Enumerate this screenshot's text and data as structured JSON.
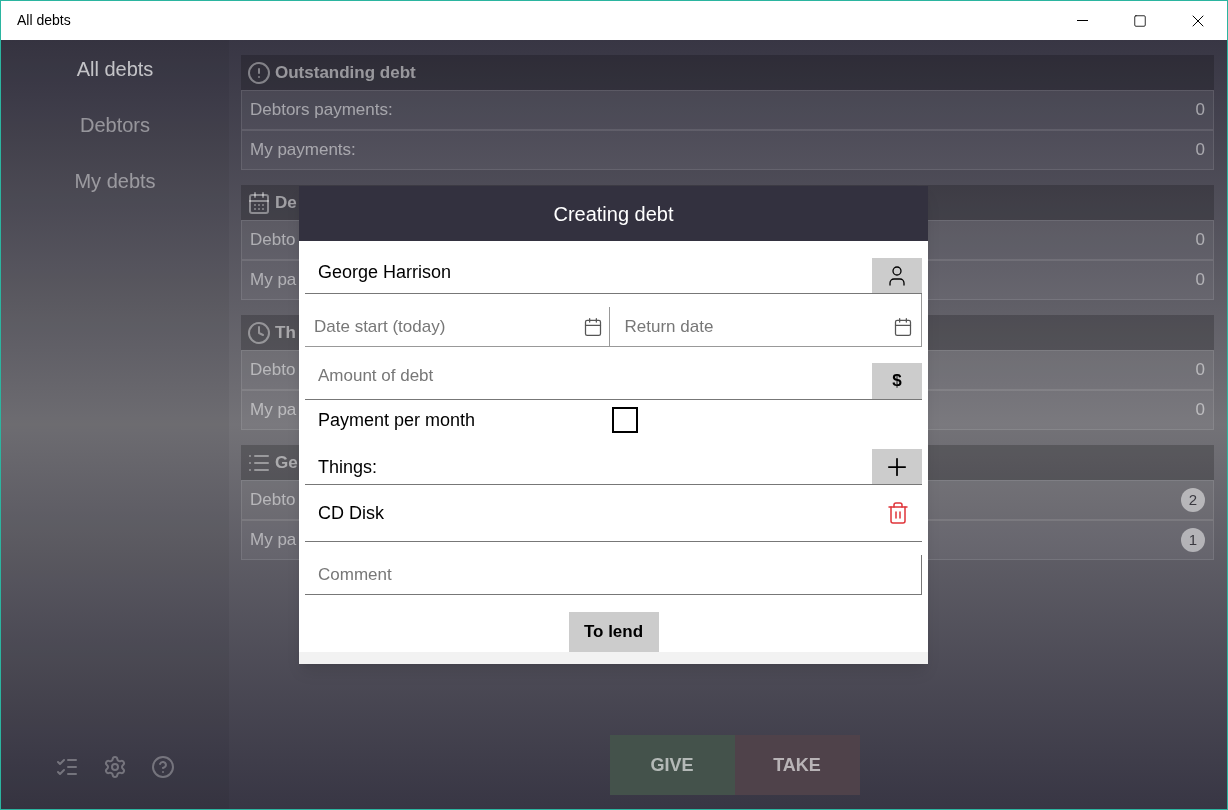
{
  "window": {
    "title": "All debts"
  },
  "sidebar": {
    "items": [
      {
        "label": "All debts",
        "selected": true
      },
      {
        "label": "Debtors",
        "selected": false
      },
      {
        "label": "My debts",
        "selected": false
      }
    ]
  },
  "sections": [
    {
      "title": "Outstanding debt",
      "rows": [
        {
          "kind": "text",
          "label": "Debtors payments:",
          "value": "0"
        },
        {
          "kind": "text",
          "label": "My payments:",
          "value": "0"
        }
      ]
    },
    {
      "title": "De",
      "rows": [
        {
          "kind": "text",
          "label": "Debto",
          "value": "0"
        },
        {
          "kind": "text",
          "label": "My pa",
          "value": "0"
        }
      ]
    },
    {
      "title": "Th",
      "rows": [
        {
          "kind": "text",
          "label": "Debto",
          "value": "0"
        },
        {
          "kind": "text",
          "label": "My pa",
          "value": "0"
        }
      ]
    },
    {
      "title": "Ge",
      "rows": [
        {
          "kind": "badge",
          "label": "Debto",
          "value": "2"
        },
        {
          "kind": "badge",
          "label": "My pa",
          "value": "1"
        }
      ]
    }
  ],
  "actions": [
    {
      "label": "GIVE",
      "color": "#44524b"
    },
    {
      "label": "TAKE",
      "color": "#4f424a"
    }
  ],
  "dialog": {
    "title": "Creating debt",
    "person": {
      "value": "George Harrison"
    },
    "date_start": {
      "placeholder": "Date start (today)"
    },
    "return_date": {
      "placeholder": "Return date"
    },
    "amount": {
      "placeholder": "Amount of debt",
      "currency": "$"
    },
    "payment_per_month": {
      "label": "Payment per month",
      "checked": false
    },
    "things": {
      "label": "Things:",
      "items": [
        {
          "name": "CD Disk"
        }
      ]
    },
    "comment": {
      "placeholder": "Comment"
    },
    "submit": "To lend"
  }
}
